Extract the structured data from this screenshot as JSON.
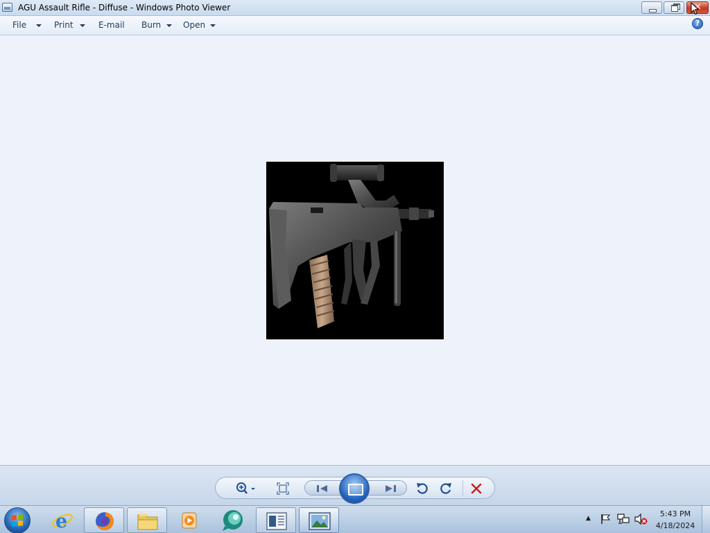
{
  "window": {
    "title": "AGU Assault Rifle - Diffuse - Windows Photo Viewer",
    "close_glyph": "✕"
  },
  "menu": {
    "file": "File",
    "print": "Print",
    "email": "E-mail",
    "burn": "Burn",
    "open": "Open",
    "help_glyph": "?"
  },
  "photo": {
    "subject": "assault-rifle-render",
    "background_color": "#000000"
  },
  "controls": {
    "zoom_icon": "zoom-icon",
    "actual_size_icon": "actual-size-icon",
    "previous_icon": "previous-icon",
    "slideshow_icon": "slideshow-icon",
    "next_icon": "next-icon",
    "rotate_ccw_icon": "rotate-counterclockwise-icon",
    "rotate_cw_icon": "rotate-clockwise-icon",
    "delete_icon": "delete-icon",
    "accent_color": "#2363bd",
    "delete_color": "#cc1f1f"
  },
  "taskbar": {
    "apps": [
      "internet-explorer",
      "firefox",
      "file-explorer",
      "media-player",
      "app-bubble",
      "document-window",
      "photo-viewer"
    ],
    "tray": {
      "time": "5:43 PM",
      "date": "4/18/2024",
      "show_hidden_glyph": "▲"
    }
  }
}
